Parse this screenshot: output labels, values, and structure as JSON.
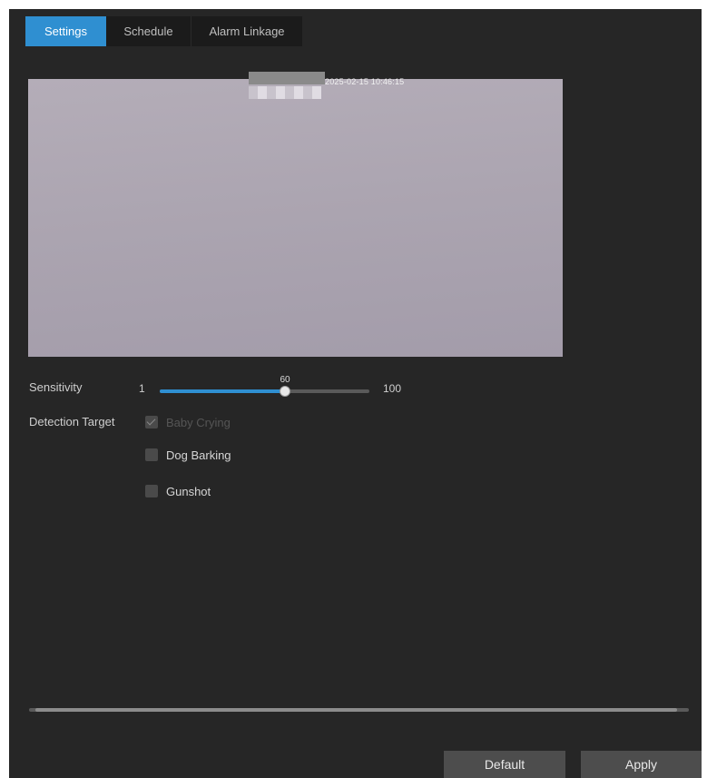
{
  "tabs": [
    {
      "label": "Settings",
      "active": true
    },
    {
      "label": "Schedule",
      "active": false
    },
    {
      "label": "Alarm Linkage",
      "active": false
    }
  ],
  "preview": {
    "timestamp": "2025-02-15 10:46:15"
  },
  "sensitivity": {
    "label": "Sensitivity",
    "min": "1",
    "max": "100",
    "value": "60"
  },
  "detection": {
    "label": "Detection Target",
    "options": [
      {
        "label": "Baby Crying",
        "checked": true,
        "disabled": true
      },
      {
        "label": "Dog Barking",
        "checked": false,
        "disabled": false
      },
      {
        "label": "Gunshot",
        "checked": false,
        "disabled": false
      }
    ]
  },
  "buttons": {
    "default_label": "Default",
    "apply_label": "Apply"
  },
  "colors": {
    "accent": "#2f8fd1",
    "background": "#262626"
  }
}
